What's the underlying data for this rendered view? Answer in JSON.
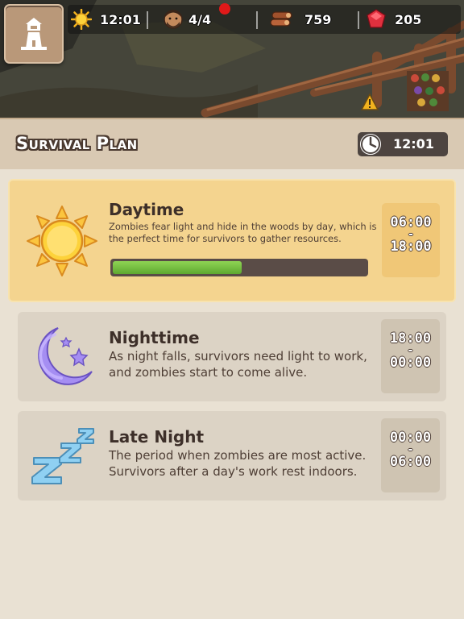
{
  "hud": {
    "time": "12:01",
    "survivors": "4/4",
    "wood": "759",
    "gems": "205"
  },
  "panel": {
    "title": "Survival Plan",
    "clock": "12:01"
  },
  "phases": [
    {
      "title": "Daytime",
      "description": "Zombies fear light and hide in the woods by day, which is the perfect time for survivors to gather resources.",
      "start": "06:00",
      "end": "18:00",
      "icon": "sun-icon",
      "active": true,
      "progress": 0.51
    },
    {
      "title": "Nighttime",
      "description": "As night falls, survivors need light to work, and zombies start to come alive.",
      "start": "18:00",
      "end": "00:00",
      "icon": "moon-icon",
      "active": false
    },
    {
      "title": "Late Night",
      "description": "The period when zombies are most active. Survivors after a day's work rest indoors.",
      "start": "00:00",
      "end": "06:00",
      "icon": "sleep-zzz-icon",
      "active": false
    }
  ],
  "colors": {
    "active_card": "#f4d48f",
    "inactive_card": "#dcd3c5",
    "progress": "#6fbe3c",
    "gem": "#e0303e"
  }
}
